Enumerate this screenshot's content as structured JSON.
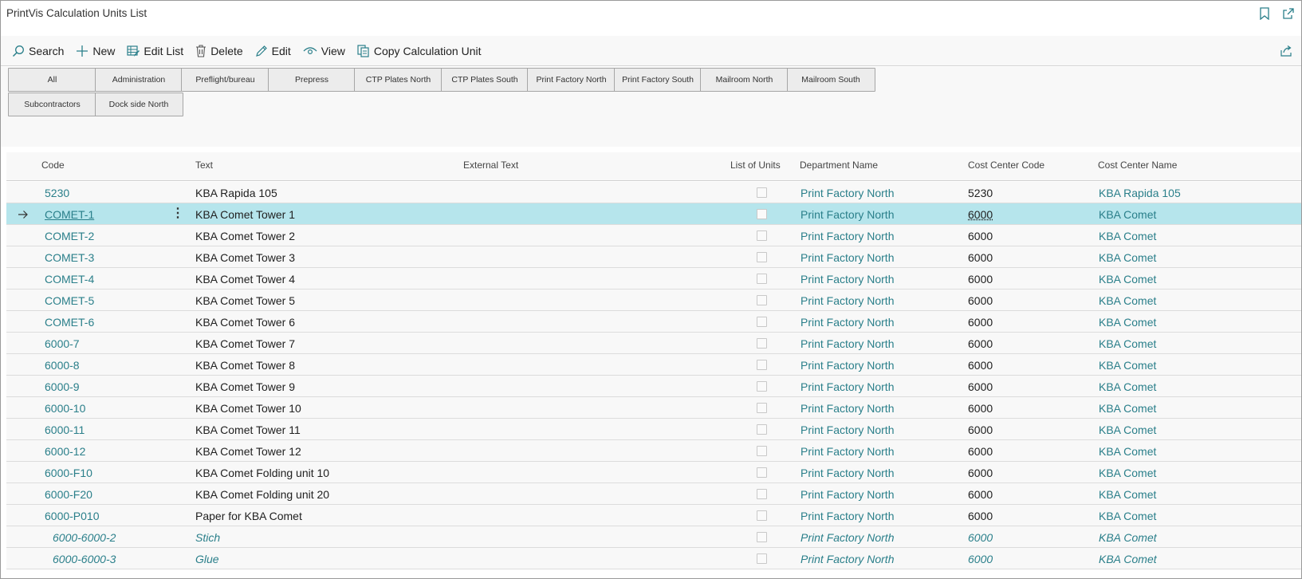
{
  "window": {
    "title": "PrintVis Calculation Units List"
  },
  "actions": [
    {
      "label": "Search",
      "icon": "search-icon"
    },
    {
      "label": "New",
      "icon": "plus-icon"
    },
    {
      "label": "Edit List",
      "icon": "edit-list-icon"
    },
    {
      "label": "Delete",
      "icon": "trash-icon"
    },
    {
      "label": "Edit",
      "icon": "pencil-icon"
    },
    {
      "label": "View",
      "icon": "eye-icon"
    },
    {
      "label": "Copy Calculation Unit",
      "icon": "copy-icon"
    }
  ],
  "filters": [
    "All",
    "Administration",
    "Preflight/bureau",
    "Prepress",
    "CTP Plates North",
    "CTP Plates South",
    "Print Factory North",
    "Print Factory South",
    "Mailroom North",
    "Mailroom South",
    "Subcontractors",
    "Dock side North"
  ],
  "columns": {
    "code": "Code",
    "text": "Text",
    "external_text": "External Text",
    "list_of_units": "List of Units",
    "department_name": "Department Name",
    "cost_center_code": "Cost Center Code",
    "cost_center_name": "Cost Center Name"
  },
  "rows": [
    {
      "code": "5230",
      "text": "KBA Rapida 105",
      "external_text": "",
      "list_of_units": false,
      "department_name": "Print Factory North",
      "cost_center_code": "5230",
      "cost_center_name": "KBA Rapida 105"
    },
    {
      "code": "COMET-1",
      "text": "KBA Comet Tower 1",
      "external_text": "",
      "list_of_units": false,
      "department_name": "Print Factory North",
      "cost_center_code": "6000",
      "cost_center_name": "KBA Comet",
      "selected": true
    },
    {
      "code": "COMET-2",
      "text": "KBA Comet Tower 2",
      "external_text": "",
      "list_of_units": false,
      "department_name": "Print Factory North",
      "cost_center_code": "6000",
      "cost_center_name": "KBA Comet"
    },
    {
      "code": "COMET-3",
      "text": "KBA Comet Tower 3",
      "external_text": "",
      "list_of_units": false,
      "department_name": "Print Factory North",
      "cost_center_code": "6000",
      "cost_center_name": "KBA Comet"
    },
    {
      "code": "COMET-4",
      "text": "KBA Comet Tower 4",
      "external_text": "",
      "list_of_units": false,
      "department_name": "Print Factory North",
      "cost_center_code": "6000",
      "cost_center_name": "KBA Comet"
    },
    {
      "code": "COMET-5",
      "text": "KBA Comet Tower 5",
      "external_text": "",
      "list_of_units": false,
      "department_name": "Print Factory North",
      "cost_center_code": "6000",
      "cost_center_name": "KBA Comet"
    },
    {
      "code": "COMET-6",
      "text": "KBA Comet Tower 6",
      "external_text": "",
      "list_of_units": false,
      "department_name": "Print Factory North",
      "cost_center_code": "6000",
      "cost_center_name": "KBA Comet"
    },
    {
      "code": "6000-7",
      "text": "KBA Comet Tower 7",
      "external_text": "",
      "list_of_units": false,
      "department_name": "Print Factory North",
      "cost_center_code": "6000",
      "cost_center_name": "KBA Comet"
    },
    {
      "code": "6000-8",
      "text": "KBA Comet Tower 8",
      "external_text": "",
      "list_of_units": false,
      "department_name": "Print Factory North",
      "cost_center_code": "6000",
      "cost_center_name": "KBA Comet"
    },
    {
      "code": "6000-9",
      "text": "KBA Comet Tower 9",
      "external_text": "",
      "list_of_units": false,
      "department_name": "Print Factory North",
      "cost_center_code": "6000",
      "cost_center_name": "KBA Comet"
    },
    {
      "code": "6000-10",
      "text": "KBA Comet Tower 10",
      "external_text": "",
      "list_of_units": false,
      "department_name": "Print Factory North",
      "cost_center_code": "6000",
      "cost_center_name": "KBA Comet"
    },
    {
      "code": "6000-11",
      "text": "KBA Comet Tower 11",
      "external_text": "",
      "list_of_units": false,
      "department_name": "Print Factory North",
      "cost_center_code": "6000",
      "cost_center_name": "KBA Comet"
    },
    {
      "code": "6000-12",
      "text": "KBA Comet Tower 12",
      "external_text": "",
      "list_of_units": false,
      "department_name": "Print Factory North",
      "cost_center_code": "6000",
      "cost_center_name": "KBA Comet"
    },
    {
      "code": "6000-F10",
      "text": "KBA Comet Folding unit 10",
      "external_text": "",
      "list_of_units": false,
      "department_name": "Print Factory North",
      "cost_center_code": "6000",
      "cost_center_name": "KBA Comet"
    },
    {
      "code": "6000-F20",
      "text": "KBA Comet Folding unit 20",
      "external_text": "",
      "list_of_units": false,
      "department_name": "Print Factory North",
      "cost_center_code": "6000",
      "cost_center_name": "KBA Comet"
    },
    {
      "code": "6000-P010",
      "text": "Paper for KBA Comet",
      "external_text": "",
      "list_of_units": false,
      "department_name": "Print Factory North",
      "cost_center_code": "6000",
      "cost_center_name": "KBA Comet"
    },
    {
      "code": "6000-6000-2",
      "text": "Stich",
      "external_text": "",
      "list_of_units": false,
      "department_name": "Print Factory North",
      "cost_center_code": "6000",
      "cost_center_name": "KBA Comet",
      "indented": true
    },
    {
      "code": "6000-6000-3",
      "text": "Glue",
      "external_text": "",
      "list_of_units": false,
      "department_name": "Print Factory North",
      "cost_center_code": "6000",
      "cost_center_name": "KBA Comet",
      "indented": true
    }
  ]
}
